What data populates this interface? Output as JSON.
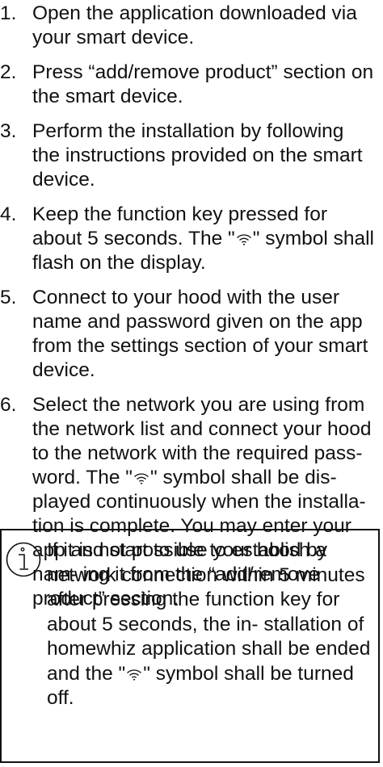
{
  "steps": [
    {
      "num": "1.",
      "text": "Open the application downloaded via your smart device."
    },
    {
      "num": "2.",
      "text": "Press “add/remove product” section on the smart device."
    },
    {
      "num": "3.",
      "text": "Perform the installation by following the instructions provided on the smart device."
    },
    {
      "num": "4.",
      "text_before": "Keep the function key pressed for about 5 seconds. The \"",
      "text_after": "\" symbol shall flash on the display."
    },
    {
      "num": "5.",
      "text": "Connect to your hood with the user name and password given on the app from the settings section of your smart device."
    },
    {
      "num": "6.",
      "text_before": "Select the network you are using from the network list and connect your hood to the network with the required pass- word. The \"",
      "text_after": "\" symbol shall be dis- played continuously when the installa- tion is complete. You may enter your app and start to use your hood by nam- ing it from the “add/remove product” section."
    }
  ],
  "note": {
    "icon": "info-icon",
    "text_before": "If it is not possible to establish a network connection within 5 minutes after pressing the function key for about 5 seconds, the in- stallation of homewhiz application shall be ended and the \"",
    "text_after": "\" symbol shall be turned off."
  },
  "symbols": {
    "wifi": "wifi-icon"
  }
}
